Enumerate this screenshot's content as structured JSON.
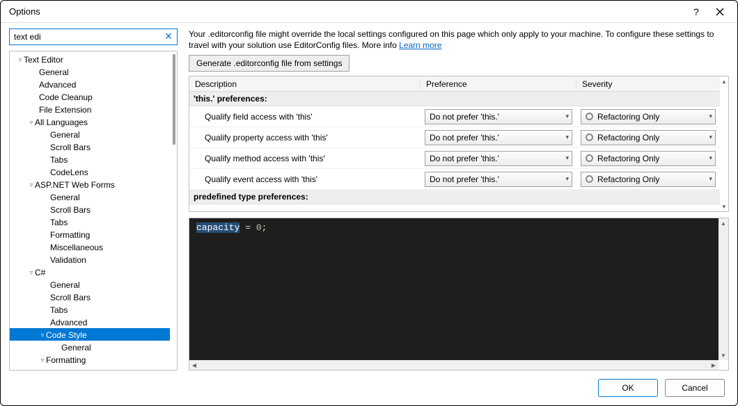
{
  "window": {
    "title": "Options"
  },
  "search": {
    "value": "text edi"
  },
  "tree": [
    {
      "indentCls": "ind1",
      "arrow": "▿",
      "label": "Text Editor",
      "selected": false
    },
    {
      "indentCls": "ind2l",
      "arrow": "",
      "label": "General"
    },
    {
      "indentCls": "ind2l",
      "arrow": "",
      "label": "Advanced"
    },
    {
      "indentCls": "ind2l",
      "arrow": "",
      "label": "Code Cleanup"
    },
    {
      "indentCls": "ind2l",
      "arrow": "",
      "label": "File Extension"
    },
    {
      "indentCls": "ind2",
      "arrow": "▿",
      "label": "All Languages"
    },
    {
      "indentCls": "ind3l",
      "arrow": "",
      "label": "General"
    },
    {
      "indentCls": "ind3l",
      "arrow": "",
      "label": "Scroll Bars"
    },
    {
      "indentCls": "ind3l",
      "arrow": "",
      "label": "Tabs"
    },
    {
      "indentCls": "ind3l",
      "arrow": "",
      "label": "CodeLens"
    },
    {
      "indentCls": "ind2",
      "arrow": "▿",
      "label": "ASP.NET Web Forms"
    },
    {
      "indentCls": "ind3l",
      "arrow": "",
      "label": "General"
    },
    {
      "indentCls": "ind3l",
      "arrow": "",
      "label": "Scroll Bars"
    },
    {
      "indentCls": "ind3l",
      "arrow": "",
      "label": "Tabs"
    },
    {
      "indentCls": "ind3l",
      "arrow": "",
      "label": "Formatting"
    },
    {
      "indentCls": "ind3l",
      "arrow": "",
      "label": "Miscellaneous"
    },
    {
      "indentCls": "ind3l",
      "arrow": "",
      "label": "Validation"
    },
    {
      "indentCls": "ind2",
      "arrow": "▿",
      "label": "C#"
    },
    {
      "indentCls": "ind3l",
      "arrow": "",
      "label": "General"
    },
    {
      "indentCls": "ind3l",
      "arrow": "",
      "label": "Scroll Bars"
    },
    {
      "indentCls": "ind3l",
      "arrow": "",
      "label": "Tabs"
    },
    {
      "indentCls": "ind3l",
      "arrow": "",
      "label": "Advanced"
    },
    {
      "indentCls": "ind3",
      "arrow": "▿",
      "label": "Code Style",
      "selected": true
    },
    {
      "indentCls": "ind4l",
      "arrow": "",
      "label": "General"
    },
    {
      "indentCls": "ind3",
      "arrow": "▿",
      "label": "Formatting"
    }
  ],
  "info": {
    "text": "Your .editorconfig file might override the local settings configured on this page which only apply to your machine. To configure these settings to travel with your solution use EditorConfig files. More info  ",
    "link": "Learn more"
  },
  "generateButton": "Generate .editorconfig file from settings",
  "columns": {
    "description": "Description",
    "preference": "Preference",
    "severity": "Severity"
  },
  "groups": [
    {
      "title": "'this.' preferences:",
      "rows": [
        {
          "desc": "Qualify field access with 'this'",
          "pref": "Do not prefer 'this.'",
          "sev": "Refactoring Only"
        },
        {
          "desc": "Qualify property access with 'this'",
          "pref": "Do not prefer 'this.'",
          "sev": "Refactoring Only"
        },
        {
          "desc": "Qualify method access with 'this'",
          "pref": "Do not prefer 'this.'",
          "sev": "Refactoring Only"
        },
        {
          "desc": "Qualify event access with 'this'",
          "pref": "Do not prefer 'this.'",
          "sev": "Refactoring Only"
        }
      ]
    },
    {
      "title": "predefined type preferences:",
      "rows": []
    }
  ],
  "preview": {
    "var": "capacity",
    "rest": " = ",
    "num": "0",
    "tail": ";"
  },
  "footer": {
    "ok": "OK",
    "cancel": "Cancel"
  }
}
